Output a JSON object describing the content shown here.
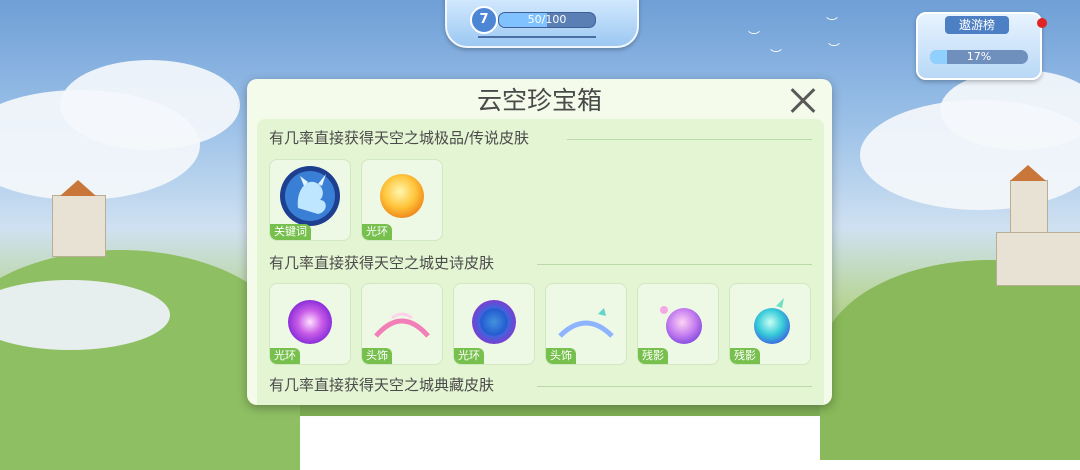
{
  "hud": {
    "level": "7",
    "exp_text": "50/100",
    "exp_fraction": 0.5,
    "rank_label": "遨游榜",
    "rank_percent_text": "17%",
    "rank_fraction": 0.17
  },
  "modal": {
    "title": "云空珍宝箱",
    "sections": [
      {
        "heading": "有几率直接获得天空之城极品/传说皮肤",
        "items": [
          {
            "tag": "关键词",
            "icon": "sky-dragon-icon"
          },
          {
            "tag": "光环",
            "icon": "golden-orb-icon"
          }
        ]
      },
      {
        "heading": "有几率直接获得天空之城史诗皮肤",
        "items": [
          {
            "tag": "光环",
            "icon": "purple-halo-icon"
          },
          {
            "tag": "头饰",
            "icon": "pink-headband-icon"
          },
          {
            "tag": "光环",
            "icon": "blue-halo-icon"
          },
          {
            "tag": "头饰",
            "icon": "blue-headband-icon"
          },
          {
            "tag": "残影",
            "icon": "purple-shadow-orb-icon"
          },
          {
            "tag": "残影",
            "icon": "teal-shadow-orb-icon"
          }
        ]
      },
      {
        "heading": "有几率直接获得天空之城典藏皮肤",
        "items": []
      }
    ]
  }
}
